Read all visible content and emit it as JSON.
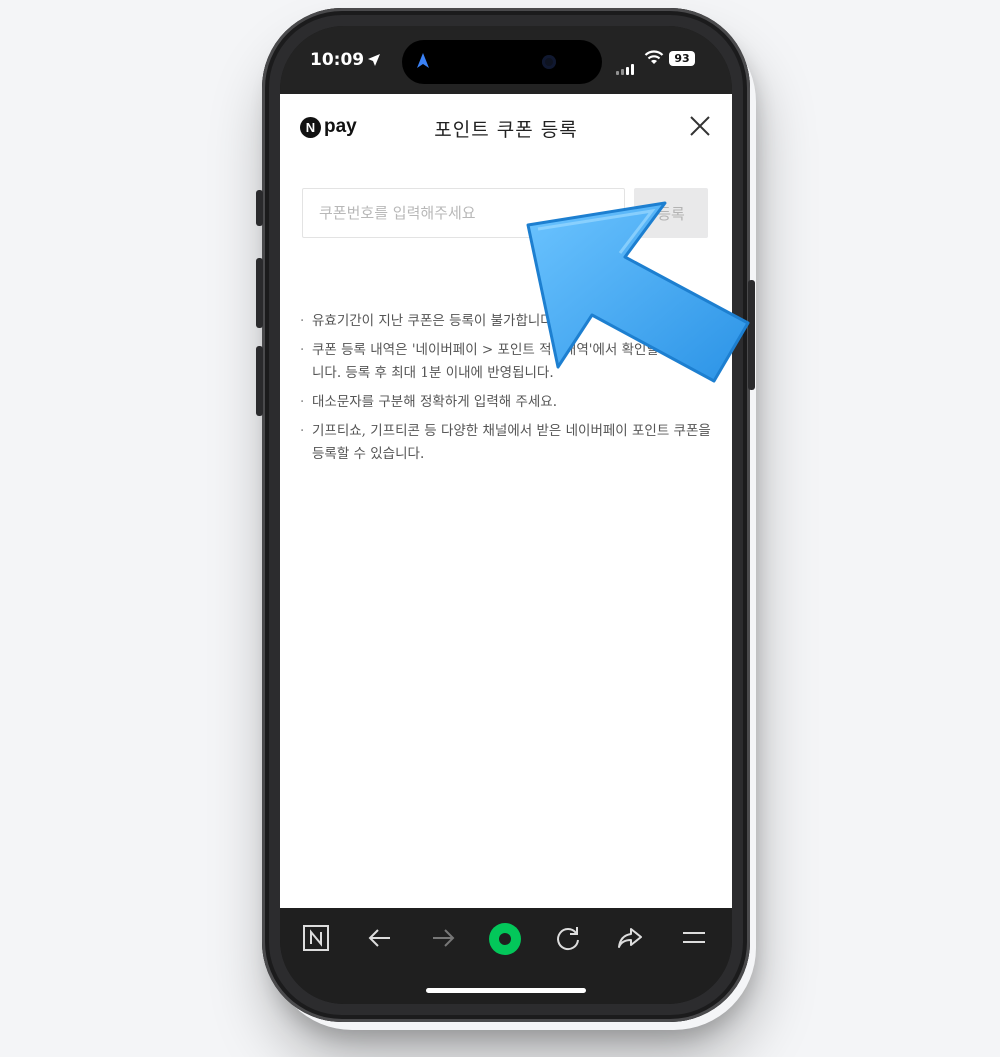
{
  "status_bar": {
    "time": "10:09",
    "battery": "93"
  },
  "header": {
    "logo_badge": "N",
    "logo_text": "pay",
    "title": "포인트 쿠폰 등록",
    "close_icon": "close-icon"
  },
  "coupon_form": {
    "placeholder": "쿠폰번호를 입력해주세요",
    "value": "",
    "register_label": "등록"
  },
  "notes": [
    "유효기간이 지난 쿠폰은 등록이 불가합니다.",
    "쿠폰 등록 내역은 '네이버페이 > 포인트 적립내역'에서 확인할 수 있습니다. 등록 후 최대 1분 이내에 반영됩니다.",
    "대소문자를 구분해 정확하게 입력해 주세요.",
    "기프티쇼, 기프티콘 등 다양한 채널에서 받은 네이버페이 포인트 쿠폰을 등록할 수 있습니다."
  ],
  "toolbar": {
    "icons": [
      "naver-icon",
      "back-icon",
      "forward-icon",
      "green-dot-icon",
      "refresh-icon",
      "share-icon",
      "menu-icon"
    ]
  },
  "colors": {
    "accent_green": "#03c75a",
    "pointer_blue": "#3aa5f0"
  }
}
